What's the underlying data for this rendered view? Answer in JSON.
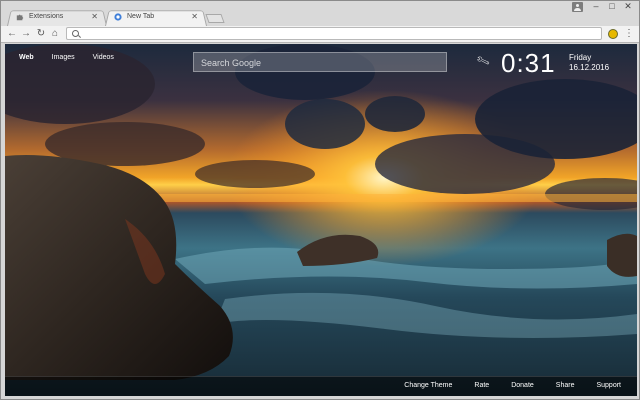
{
  "browser": {
    "tabs": [
      {
        "label": "Extensions",
        "active": false
      },
      {
        "label": "New Tab",
        "active": true
      }
    ],
    "window_controls": [
      "minimize",
      "maximize",
      "close"
    ]
  },
  "page": {
    "nav": [
      "Web",
      "Images",
      "Videos"
    ],
    "search_placeholder": "Search Google",
    "clock": "0:31",
    "day": "Friday",
    "date": "16.12.2016",
    "footer_links": [
      "Change Theme",
      "Rate",
      "Donate",
      "Share",
      "Support"
    ]
  },
  "colors": {
    "tab_active": "#f2f2f2",
    "tab_inactive": "#e6e6e6",
    "sky_top": "#1d2a3d",
    "sunset": "#f2a528",
    "sea": "#3d7386"
  },
  "icons": {
    "extensions_tab": "puzzle-icon",
    "newtab_tab": "chrome-icon",
    "nav_back": "arrow-left-icon",
    "nav_forward": "arrow-right-icon",
    "reload": "reload-icon",
    "home": "home-icon",
    "omnibox": "search-icon",
    "extension": "extension-icon",
    "menu": "kebab-menu-icon",
    "settings": "wrench-icon"
  }
}
